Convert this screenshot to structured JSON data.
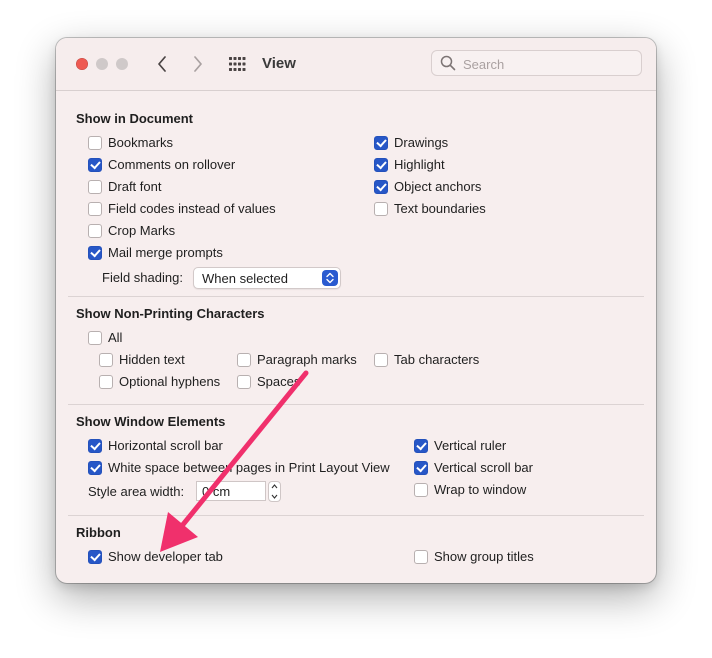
{
  "window": {
    "title": "View",
    "search_placeholder": "Search",
    "traffic_lights": {
      "close": "#ee5a52",
      "inactive": "#cfc9c9"
    },
    "icons": {
      "back": "chevron-left-icon",
      "forward": "chevron-right-icon",
      "grid": "grid-icon",
      "search": "magnifier-icon"
    }
  },
  "sections": {
    "show_in_document": {
      "title": "Show in Document",
      "items": [
        {
          "label": "Bookmarks",
          "checked": false
        },
        {
          "label": "Comments on rollover",
          "checked": true
        },
        {
          "label": "Draft font",
          "checked": false
        },
        {
          "label": "Field codes instead of values",
          "checked": false
        },
        {
          "label": "Crop Marks",
          "checked": false
        },
        {
          "label": "Mail merge prompts",
          "checked": true
        },
        {
          "label": "Drawings",
          "checked": true
        },
        {
          "label": "Highlight",
          "checked": true
        },
        {
          "label": "Object anchors",
          "checked": true
        },
        {
          "label": "Text boundaries",
          "checked": false
        }
      ],
      "field_shading_label": "Field shading:",
      "field_shading_value": "When selected"
    },
    "non_printing": {
      "title": "Show Non-Printing Characters",
      "items": [
        {
          "label": "All",
          "checked": false
        },
        {
          "label": "Hidden text",
          "checked": false
        },
        {
          "label": "Optional hyphens",
          "checked": false
        },
        {
          "label": "Paragraph marks",
          "checked": false
        },
        {
          "label": "Spaces",
          "checked": false
        },
        {
          "label": "Tab characters",
          "checked": false
        }
      ]
    },
    "window_elements": {
      "title": "Show Window Elements",
      "items": [
        {
          "label": "Horizontal scroll bar",
          "checked": true
        },
        {
          "label": "White space between pages in Print Layout View",
          "checked": true
        },
        {
          "label": "Vertical ruler",
          "checked": true
        },
        {
          "label": "Vertical scroll bar",
          "checked": true
        },
        {
          "label": "Wrap to window",
          "checked": false
        }
      ],
      "style_area_label": "Style area width:",
      "style_area_value": "0 cm"
    },
    "ribbon": {
      "title": "Ribbon",
      "items": [
        {
          "label": "Show developer tab",
          "checked": true
        },
        {
          "label": "Show group titles",
          "checked": false
        }
      ]
    }
  },
  "colors": {
    "accent": "#2757c7",
    "arrow": "#f0306c",
    "window_bg": "#f7eeee"
  }
}
